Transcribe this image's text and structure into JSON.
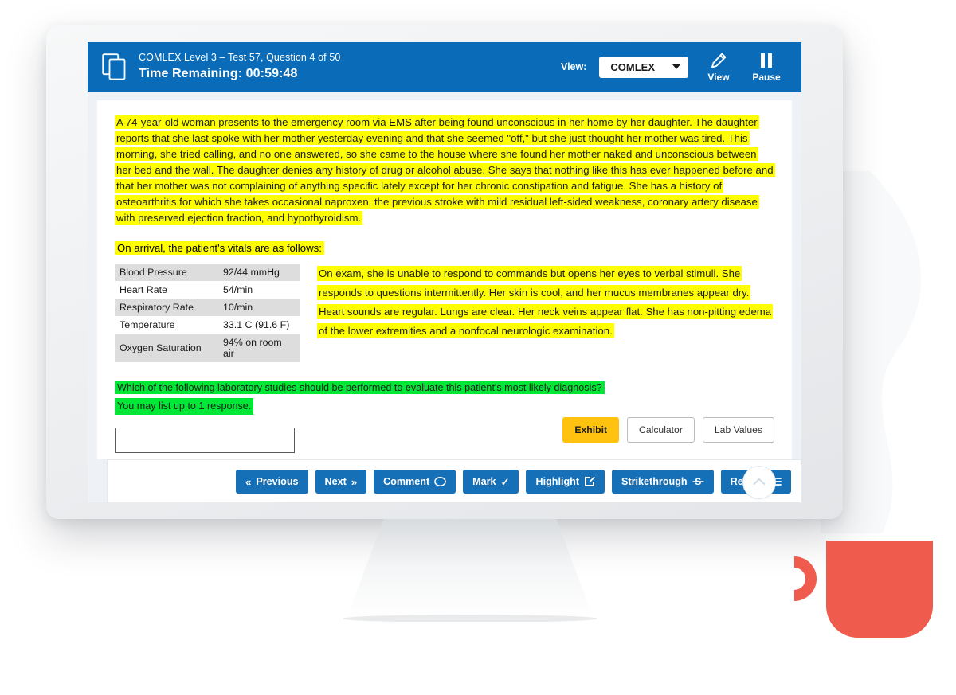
{
  "header": {
    "doc_icon": "document-copy-icon",
    "subtitle": "COMLEX Level 3 – Test 57, Question 4 of 50",
    "timer": "Time Remaining: 00:59:48",
    "view_label": "View:",
    "view_value": "COMLEX",
    "view_options": [
      "COMLEX"
    ],
    "tools": [
      {
        "icon": "pencil-icon",
        "label": "View"
      },
      {
        "icon": "pause-icon",
        "label": "Pause"
      }
    ],
    "bar_color": "#0a6cb8"
  },
  "question": {
    "stem": "A 74-year-old woman presents to the emergency room via EMS after being found unconscious in her home by her daughter. The daughter reports that she last spoke with her mother yesterday evening and that she seemed \"off,\" but she just thought her mother was tired. This morning, she tried calling, and no one answered, so she came to the house where she found her mother naked and unconscious between her bed and the wall. The daughter denies any history of drug or alcohol abuse. She says that nothing like this has ever happened before and that her mother was not complaining of anything specific lately except for her chronic constipation and fatigue. She has a history of osteoarthritis for which she takes occasional naproxen, the previous stroke with mild residual left-sided weakness, coronary artery disease with preserved ejection fraction, and hypothyroidism.",
    "vitals_intro": "On arrival, the patient's vitals are as follows:",
    "vitals": [
      {
        "label": "Blood Pressure",
        "value": "92/44 mmHg"
      },
      {
        "label": "Heart Rate",
        "value": "54/min"
      },
      {
        "label": "Respiratory Rate",
        "value": "10/min"
      },
      {
        "label": "Temperature",
        "value": "33.1 C (91.6 F)"
      },
      {
        "label": "Oxygen Saturation",
        "value": "94% on room air"
      }
    ],
    "exam": "On exam, she is unable to respond to commands but opens her eyes to verbal stimuli. She responds to questions intermittently. Her skin is cool, and her mucus membranes appear dry. Heart sounds are regular. Lungs are clear. Her neck veins appear flat. She has non-pitting edema of the lower extremities and a nonfocal neurologic examination.",
    "prompt_line1": "Which of the following laboratory studies should be performed to evaluate this patient's most likely diagnosis?",
    "prompt_line2": "You may list up to 1 response.",
    "answer_value": "",
    "answer_placeholder": "",
    "highlight_yellow": "#ffff00",
    "highlight_green": "#00e835"
  },
  "tool_buttons": [
    {
      "label": "Exhibit",
      "style": "primary"
    },
    {
      "label": "Calculator",
      "style": "outline"
    },
    {
      "label": "Lab Values",
      "style": "outline"
    }
  ],
  "toolbar": {
    "buttons": [
      {
        "label": "Previous",
        "icon": "chevron-double-left-icon",
        "glyph": "«",
        "icon_first": true
      },
      {
        "label": "Next",
        "icon": "chevron-double-right-icon",
        "glyph": "»",
        "icon_first": false
      },
      {
        "label": "Comment",
        "icon": "speech-bubble-icon",
        "glyph": "◯",
        "icon_first": false
      },
      {
        "label": "Mark",
        "icon": "checkmark-icon",
        "glyph": "✓",
        "icon_first": false
      },
      {
        "label": "Highlight",
        "icon": "highlight-pen-icon",
        "glyph": "✎",
        "icon_first": false
      },
      {
        "label": "Strikethrough",
        "icon": "strikethrough-icon",
        "glyph": "S̶",
        "icon_first": false
      },
      {
        "label": "Review",
        "icon": "list-icon",
        "glyph": "☰",
        "icon_first": false
      }
    ],
    "collapse_icon": "chevron-up-icon",
    "button_color": "#1670b8"
  },
  "decor": {
    "mug_color": "#ef5b4c",
    "wave_color": "#f7f8f9",
    "monitor_color": "#eceef0"
  }
}
